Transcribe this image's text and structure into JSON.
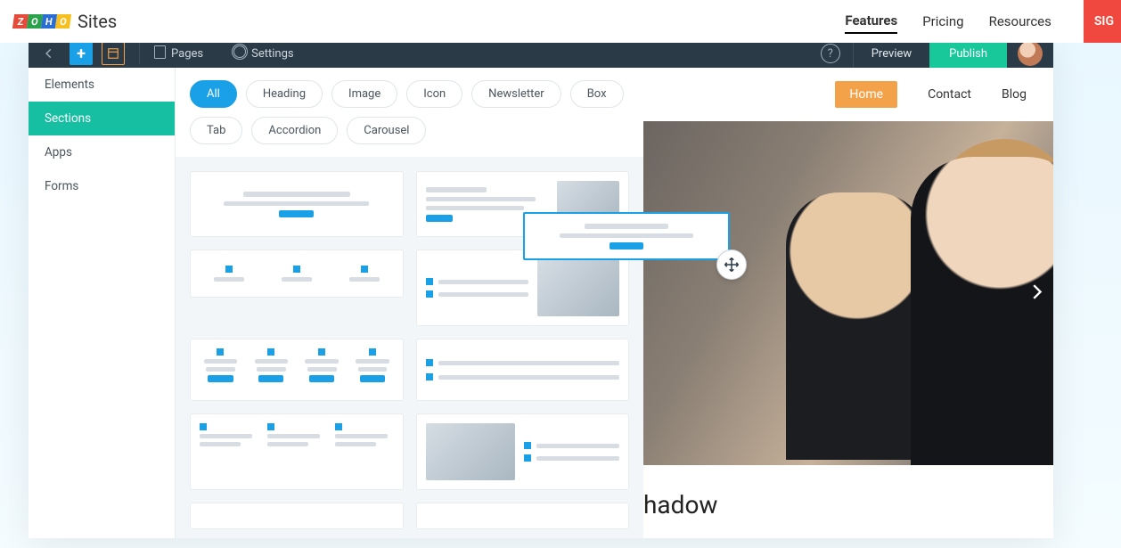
{
  "topbar": {
    "brand": "Sites",
    "nav": {
      "features": "Features",
      "pricing": "Pricing",
      "resources": "Resources"
    },
    "signin": "SIG"
  },
  "editor_bar": {
    "pages": "Pages",
    "settings": "Settings",
    "preview": "Preview",
    "publish": "Publish"
  },
  "sidebar": {
    "items": [
      {
        "label": "Elements"
      },
      {
        "label": "Sections"
      },
      {
        "label": "Apps"
      },
      {
        "label": "Forms"
      }
    ]
  },
  "chips": {
    "items": [
      {
        "label": "All",
        "active": true
      },
      {
        "label": "Heading"
      },
      {
        "label": "Image"
      },
      {
        "label": "Icon"
      },
      {
        "label": "Newsletter"
      },
      {
        "label": "Box"
      },
      {
        "label": "Tab"
      },
      {
        "label": "Accordion"
      },
      {
        "label": "Carousel"
      }
    ]
  },
  "site_nav": {
    "home": "Home",
    "contact": "Contact",
    "blog": "Blog"
  },
  "canvas": {
    "heading_fragment": "hadow"
  }
}
